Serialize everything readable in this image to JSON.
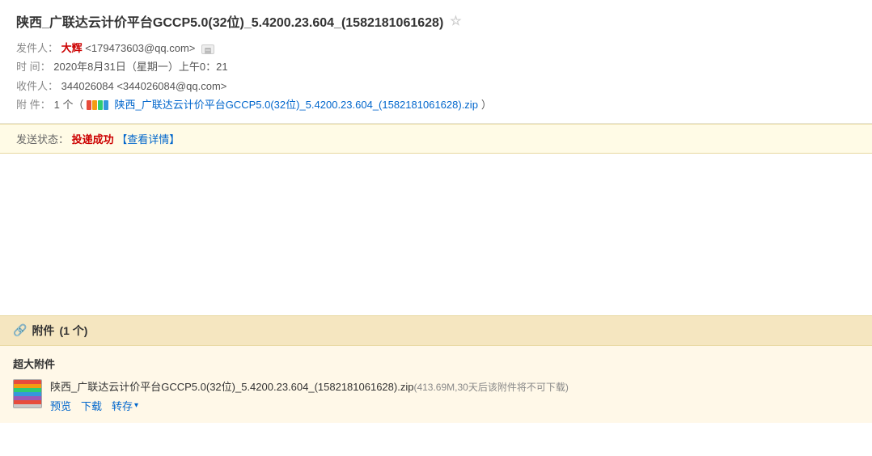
{
  "email": {
    "subject": "陕西_广联达云计价平台GCCP5.0(32位)_5.4200.23.604_(1582181061628)",
    "star_label": "☆",
    "sender_label": "发件人：",
    "sender_name": "大辉",
    "sender_email": "<179473603@qq.com>",
    "time_label": "时  间：",
    "time_value": "2020年8月31日（星期一）上午0：21",
    "recipient_label": "收件人：",
    "recipient_value": "344026084 <344026084@qq.com>",
    "attachment_label": "附  件：",
    "attachment_count_text": "1 个（",
    "attachment_filename_header": "陕西_广联达云计价平台GCCP5.0(32位)_5.4200.23.604_(1582181061628).zip",
    "attachment_close_paren": "）",
    "send_status_label": "发送状态：",
    "send_status_value": "投递成功",
    "send_status_detail": "【查看详情】",
    "attachment_section_title": "附件",
    "attachment_section_count": "(1 个)",
    "oversized_label": "超大附件",
    "attachment_filename_body": "陕西_广联达云计价平台GCCP5.0(32位)_5.4200.23.604_(1582181061628).zip",
    "attachment_file_note": "(413.69M,30天后该附件将不可下载)",
    "action_preview": "预览",
    "action_download": "下载",
    "action_save": "转存",
    "paperclip": "📎"
  }
}
